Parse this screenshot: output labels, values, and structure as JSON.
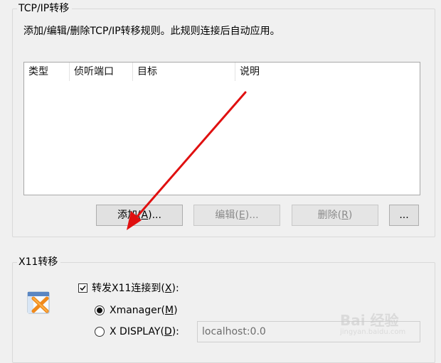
{
  "tcpip": {
    "group_title": "TCP/IP转移",
    "description": "添加/编辑/删除TCP/IP转移规则。此规则连接后自动应用。",
    "columns": [
      "类型",
      "侦听端口",
      "目标",
      "说明"
    ],
    "buttons": {
      "add": {
        "label": "添加",
        "hotkey": "A",
        "suffix": "..."
      },
      "edit": {
        "label": "编辑",
        "hotkey": "E",
        "suffix": "..."
      },
      "delete": {
        "label": "删除",
        "hotkey": "R",
        "suffix": ""
      },
      "more": {
        "label": "..."
      }
    }
  },
  "x11": {
    "group_title": "X11转移",
    "forward_checkbox": {
      "label": "转发X11连接到",
      "hotkey": "X",
      "suffix": ":",
      "checked": true
    },
    "xmanager_radio": {
      "label": "Xmanager",
      "hotkey": "M",
      "selected": true
    },
    "xdisplay_radio": {
      "label": "X DISPLAY",
      "hotkey": "D",
      "suffix": ":",
      "selected": false
    },
    "xdisplay_value": "localhost:0.0",
    "icon": "xmanager-x-icon"
  },
  "annotation": {
    "color": "#e01010"
  },
  "watermark": {
    "text": "Bai 经验",
    "sub": "jingyan.baidu.com"
  }
}
